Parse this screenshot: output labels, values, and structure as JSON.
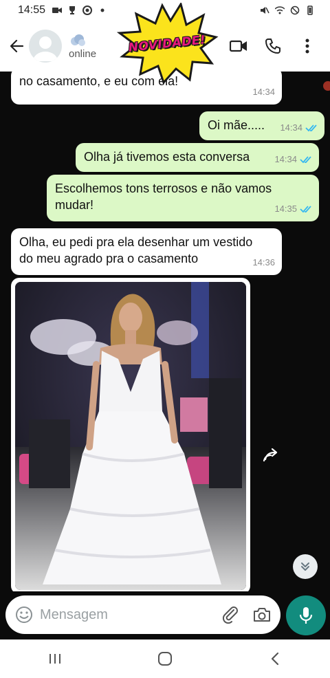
{
  "status_bar": {
    "time": "14:55"
  },
  "header": {
    "contact_status": "online",
    "promo_label": "NOVIDADE!"
  },
  "messages": [
    {
      "text": "no casamento,  e eu        com ela!",
      "time": "14:34"
    },
    {
      "text": "Oi mãe.....",
      "time": "14:34"
    },
    {
      "text": "Olha já tivemos esta conversa",
      "time": "14:34"
    },
    {
      "text": "Escolhemos tons terrosos e não vamos mudar!",
      "time": "14:35"
    },
    {
      "text": "Olha, eu pedi pra ela desenhar um vestido do meu agrado pra o casamento",
      "time": "14:36"
    }
  ],
  "input": {
    "placeholder": "Mensagem"
  },
  "colors": {
    "accent": "#128c7e",
    "outgoing_bubble": "#dcf8c6",
    "incoming_bubble": "#ffffff",
    "read_tick": "#34b7f1",
    "chat_background": "#0b0b0b"
  },
  "icons": {
    "back": "arrow-left-icon",
    "video_call": "video-camera-icon",
    "voice_call": "phone-icon",
    "menu": "more-vertical-icon",
    "emoji": "smiley-icon",
    "attach": "paperclip-icon",
    "camera": "camera-icon",
    "mic": "microphone-icon",
    "forward": "forward-icon",
    "scroll_down": "double-chevron-down-icon"
  }
}
